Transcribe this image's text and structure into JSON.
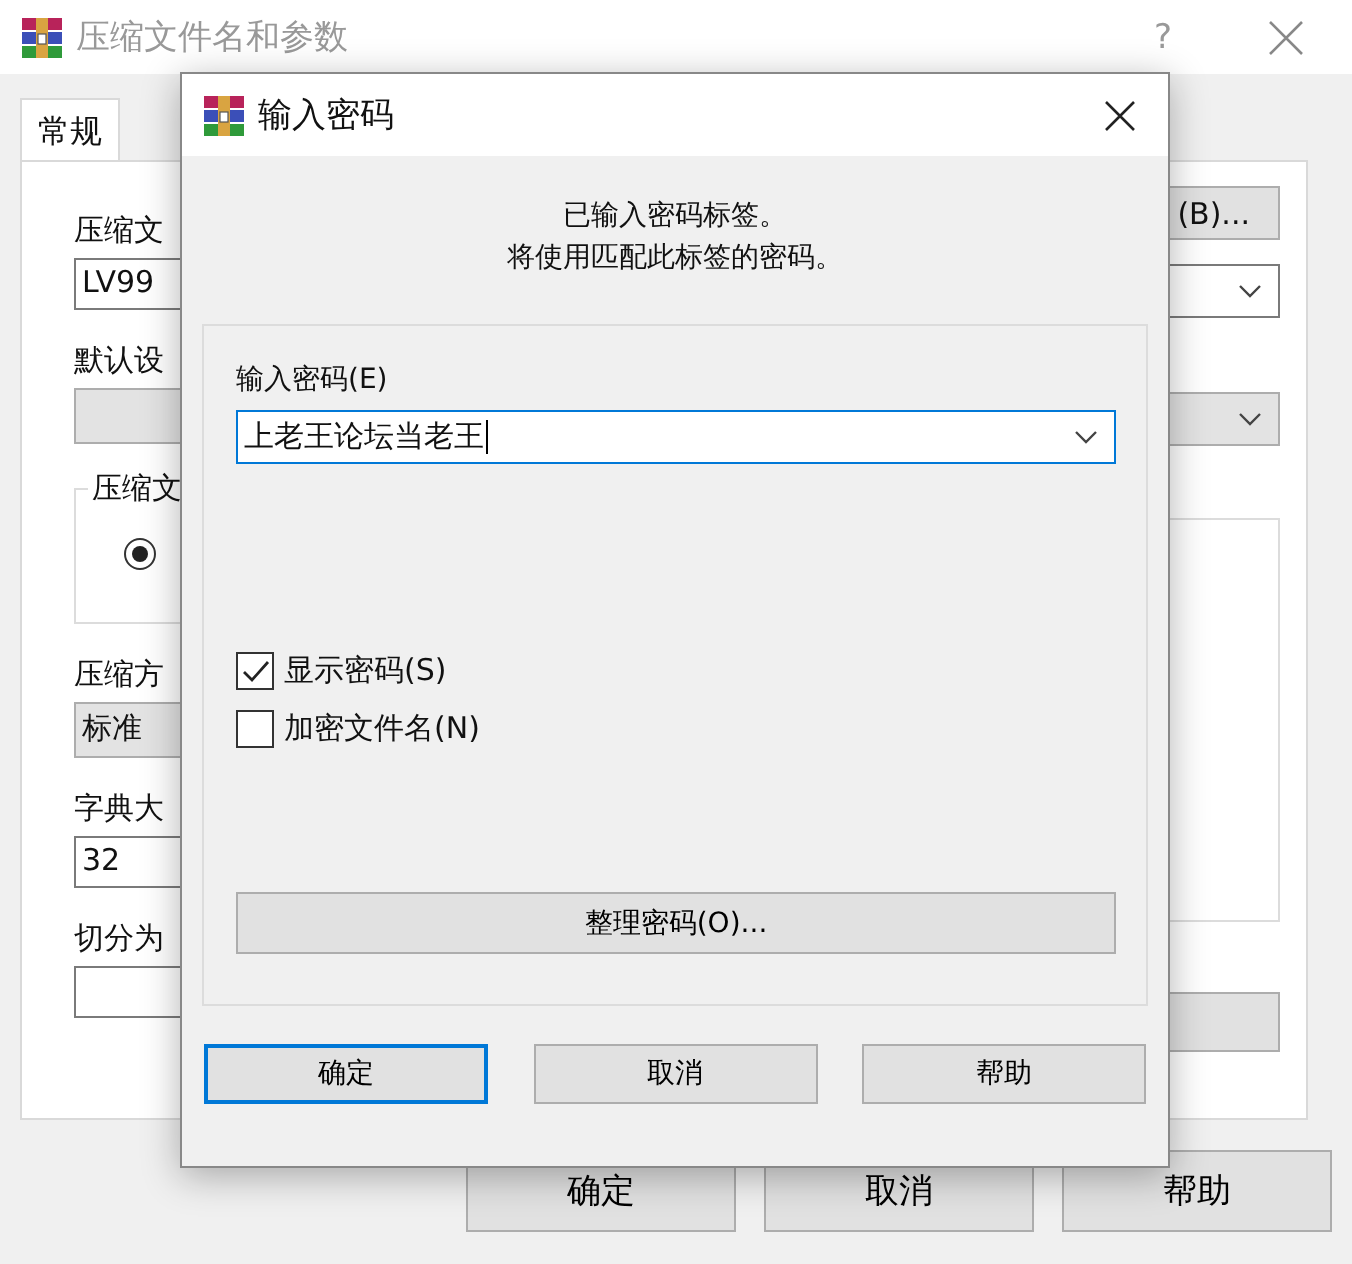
{
  "main_window": {
    "title": "压缩文件名和参数",
    "help": "?",
    "tabs": [
      {
        "label": "常规",
        "selected": true
      }
    ],
    "left_fields": [
      {
        "kind": "label",
        "text": "压缩文"
      },
      {
        "kind": "input",
        "value": "LV99"
      },
      {
        "kind": "label",
        "text": "默认设"
      },
      {
        "kind": "dropdown",
        "disabled": true
      },
      {
        "kind": "group",
        "label": "压缩文",
        "radio_selected": true
      },
      {
        "kind": "label",
        "text": "压缩方"
      },
      {
        "kind": "dropdown",
        "disabled": true,
        "value": "标准"
      },
      {
        "kind": "label",
        "text": "字典大"
      },
      {
        "kind": "input",
        "value": "32"
      },
      {
        "kind": "label",
        "text": "切分为"
      },
      {
        "kind": "input"
      }
    ],
    "right_fields": [
      {
        "kind": "button",
        "label": "(B)..."
      },
      {
        "kind": "dropdown",
        "disabled": false
      },
      {
        "kind": "dropdown",
        "disabled": true
      },
      {
        "kind": "list"
      },
      {
        "kind": "button"
      }
    ],
    "buttons": [
      "确定",
      "取消",
      "帮助"
    ]
  },
  "dialog": {
    "title": "输入密码",
    "message": [
      "已输入密码标签。",
      "将使用匹配此标签的密码。"
    ],
    "password_label": "输入密码(E)",
    "password_value": "上老王论坛当老王",
    "checkboxes": [
      {
        "label": "显示密码(S)",
        "checked": true
      },
      {
        "label": "加密文件名(N)",
        "checked": false
      }
    ],
    "organize_button": "整理密码(O)...",
    "buttons": [
      {
        "label": "确定",
        "default": true
      },
      {
        "label": "取消",
        "default": false
      },
      {
        "label": "帮助",
        "default": false
      }
    ]
  }
}
